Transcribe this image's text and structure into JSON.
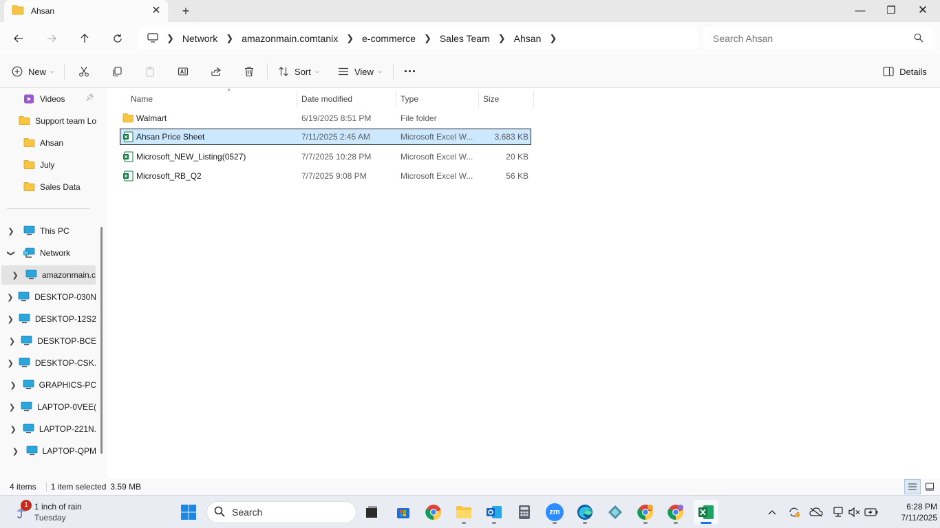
{
  "window": {
    "tab_title": "Ahsan",
    "new_tab": "+",
    "minimize": "—",
    "maximize": "❐",
    "close": "✕"
  },
  "address": {
    "crumbs": [
      "Network",
      "amazonmain.comtanix",
      "e-commerce",
      "Sales Team",
      "Ahsan"
    ],
    "search_placeholder": "Search Ahsan"
  },
  "commands": {
    "new": "New",
    "sort": "Sort",
    "view": "View",
    "more": "···",
    "details": "Details"
  },
  "sidebar": {
    "quick_access": [
      {
        "label": "Videos",
        "icon": "videos-icon",
        "pinned": true
      },
      {
        "label": "Support team Lo",
        "icon": "folder-icon"
      },
      {
        "label": "Ahsan",
        "icon": "folder-icon"
      },
      {
        "label": "July",
        "icon": "folder-icon"
      },
      {
        "label": "Sales Data",
        "icon": "folder-icon"
      }
    ],
    "tree": [
      {
        "label": "This PC",
        "expanded": false
      },
      {
        "label": "Network",
        "expanded": true
      }
    ],
    "network_items": [
      {
        "label": "amazonmain.c",
        "selected": true
      },
      {
        "label": "DESKTOP-030N"
      },
      {
        "label": "DESKTOP-12S2"
      },
      {
        "label": "DESKTOP-BCE"
      },
      {
        "label": "DESKTOP-CSK."
      },
      {
        "label": "GRAPHICS-PC"
      },
      {
        "label": "LAPTOP-0VEE("
      },
      {
        "label": "LAPTOP-221N."
      },
      {
        "label": "LAPTOP-QPM"
      }
    ]
  },
  "files": {
    "columns": [
      "Name",
      "Date modified",
      "Type",
      "Size"
    ],
    "rows": [
      {
        "name": "Walmart",
        "date": "6/19/2025 8:51 PM",
        "type": "File folder",
        "size": "",
        "icon": "folder-icon"
      },
      {
        "name": "Ahsan Price Sheet",
        "date": "7/11/2025 2:45 AM",
        "type": "Microsoft Excel W...",
        "size": "3,683 KB",
        "icon": "excel-file-icon",
        "selected": true
      },
      {
        "name": "Microsoft_NEW_Listing(0527)",
        "date": "7/7/2025 10:28 PM",
        "type": "Microsoft Excel W...",
        "size": "20 KB",
        "icon": "excel-file-icon"
      },
      {
        "name": "Microsoft_RB_Q2",
        "date": "7/7/2025 9:08 PM",
        "type": "Microsoft Excel W...",
        "size": "56 KB",
        "icon": "excel-file-icon"
      }
    ]
  },
  "status": {
    "count": "4 items",
    "selection": "1 item selected",
    "size": "3.59 MB"
  },
  "taskbar": {
    "weather_badge": "1",
    "weather_text": "1 inch of rain",
    "weather_day": "Tuesday",
    "search_label": "Search",
    "zoom_label": "zm",
    "time": "6:28 PM",
    "date": "7/11/2025"
  },
  "colors": {
    "selection": "#cce8ff",
    "accent": "#1a73e8",
    "folder": "#f8c542",
    "excel": "#107c41"
  }
}
